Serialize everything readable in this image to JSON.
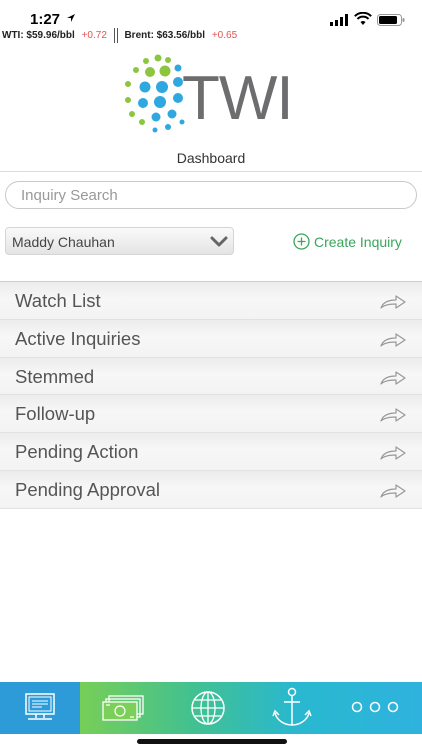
{
  "status": {
    "time": "1:27"
  },
  "ticker": {
    "wti_label": "WTI: $59.96/bbl",
    "wti_change": "+0.72",
    "brent_label": "Brent: $63.56/bbl",
    "brent_change": "+0.65"
  },
  "brand": {
    "logo_text": "TWI",
    "page_title": "Dashboard"
  },
  "search": {
    "placeholder": "Inquiry Search",
    "value": ""
  },
  "user_select": {
    "selected": "Maddy Chauhan"
  },
  "create_inquiry": {
    "label": "Create Inquiry"
  },
  "menu": {
    "items": [
      {
        "label": "Watch List"
      },
      {
        "label": "Active Inquiries"
      },
      {
        "label": "Stemmed"
      },
      {
        "label": "Follow-up"
      },
      {
        "label": "Pending Action"
      },
      {
        "label": "Pending Approval"
      }
    ]
  },
  "tabs": [
    {
      "icon": "dashboard-icon",
      "active": true
    },
    {
      "icon": "money-icon",
      "active": false
    },
    {
      "icon": "globe-icon",
      "active": false
    },
    {
      "icon": "anchor-icon",
      "active": false
    },
    {
      "icon": "more-icon",
      "active": false
    }
  ],
  "colors": {
    "accent_green": "#3aa55c",
    "ticker_up": "#e05555",
    "tab_active": "#2e9bd9"
  }
}
